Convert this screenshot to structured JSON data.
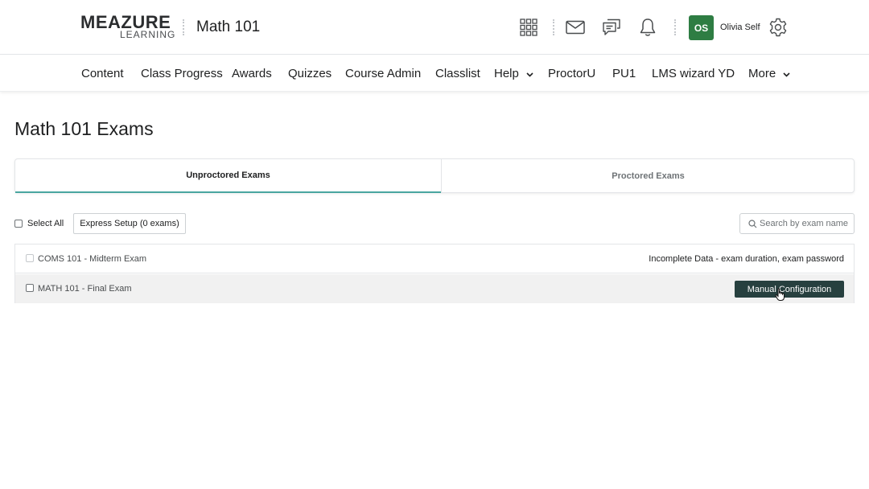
{
  "header": {
    "logo_top": "MEAZURE",
    "logo_bottom": "LEARNING",
    "course_title": "Math 101",
    "icons": [
      "apps-grid-icon",
      "mail-icon",
      "chat-icon",
      "bell-icon",
      "gear-icon"
    ],
    "avatar_initials": "OS",
    "user_name": "Olivia Self",
    "avatar_color": "#2e7d43"
  },
  "navbar": {
    "items": [
      {
        "label": "Content"
      },
      {
        "label": "Class Progress"
      },
      {
        "label": "Awards"
      },
      {
        "label": "Quizzes"
      },
      {
        "label": "Course Admin"
      },
      {
        "label": "Classlist"
      },
      {
        "label": "Help",
        "has_dropdown": true
      },
      {
        "label": "ProctorU"
      },
      {
        "label": "PU1"
      },
      {
        "label": "LMS wizard YD"
      },
      {
        "label": "More",
        "has_dropdown": true
      }
    ]
  },
  "main": {
    "page_title": "Math 101 Exams",
    "tabs": [
      {
        "label": "Unproctored Exams",
        "active": true
      },
      {
        "label": "Proctored Exams",
        "active": false
      }
    ],
    "select_all_label": "Select All",
    "express_setup_label": "Express Setup (0 exams)",
    "search": {
      "placeholder": "Search by exam name",
      "value": ""
    },
    "exams": [
      {
        "name": "COMS 101 - Midterm Exam",
        "status": "Incomplete Data - exam duration, exam password",
        "checkbox_enabled": false
      },
      {
        "name": "MATH 101 - Final Exam",
        "action_label": "Manual Configuration",
        "checkbox_enabled": true
      }
    ],
    "accent_color": "#4aa6a0",
    "button_color": "#27403f"
  }
}
